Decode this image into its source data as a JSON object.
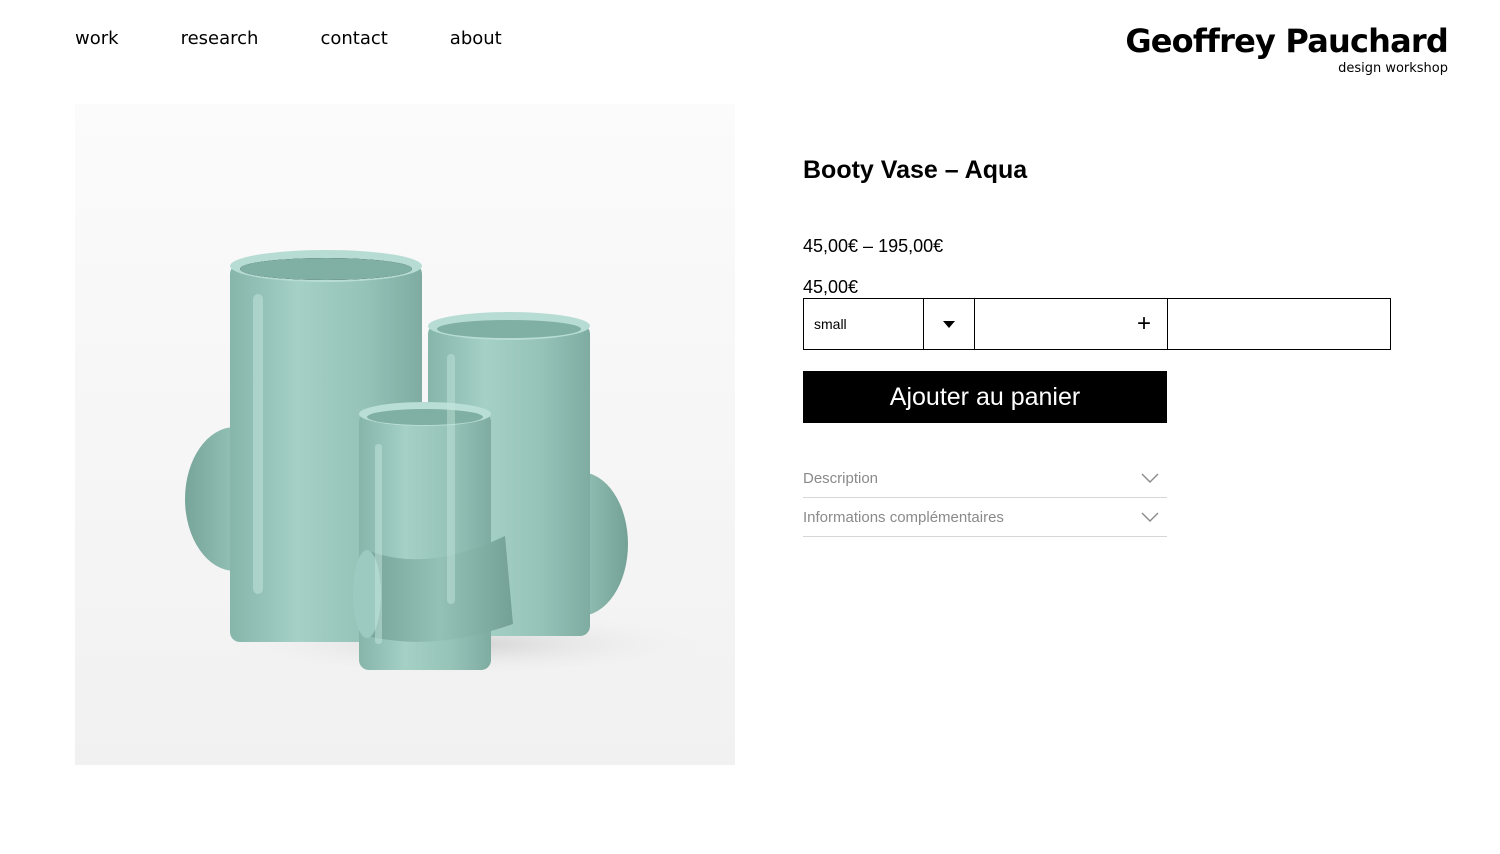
{
  "nav": {
    "items": [
      {
        "label": "work"
      },
      {
        "label": "research"
      },
      {
        "label": "contact"
      },
      {
        "label": "about"
      }
    ]
  },
  "brand": {
    "name": "Geoffrey Pauchard",
    "tagline": "design workshop"
  },
  "product": {
    "title": "Booty Vase – Aqua",
    "price_range": "45,00€ – 195,00€",
    "current_price": "45,00€",
    "variant": {
      "selected": "small"
    },
    "add_to_cart_label": "Ajouter au panier",
    "accordion": [
      {
        "label": "Description"
      },
      {
        "label": "Informations complémentaires"
      }
    ]
  },
  "icons": {
    "select_toggle": "caret-down-icon",
    "quantity_increment": "plus-icon",
    "accordion_toggle": "chevron-down-icon"
  },
  "colors": {
    "accent": "#000000",
    "vase_glaze": "#9cc9bf",
    "muted_text": "#8a8a8a",
    "divider": "#d6d6d6"
  }
}
